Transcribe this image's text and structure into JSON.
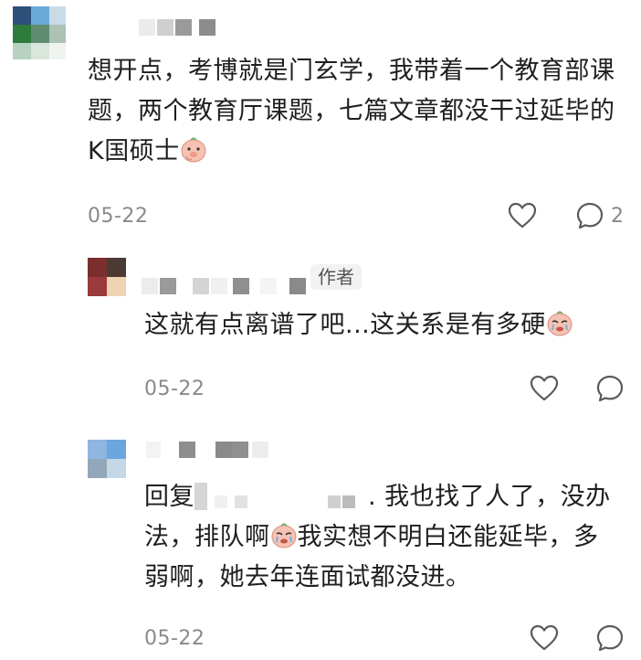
{
  "comments": [
    {
      "date": "05-22",
      "like_count": "",
      "reply_count": "2",
      "lines": [
        "想开点，考博就是门玄学，我带着一个教育部课",
        "题，两个教育厅课题，七篇文章都没干过延毕的",
        "K国硕士"
      ]
    }
  ],
  "replies": [
    {
      "author_tag": "作者",
      "date": "05-22",
      "text": "这就有点离谱了吧...这关系是有多硬"
    },
    {
      "date": "05-22",
      "prefix": "回复",
      "line1_tail": ". 我也找了人了，没办",
      "line2_a": "法，排队啊",
      "line2_b": "我实想不明白还能延毕，多",
      "line3": "弱啊，她去年连面试都没进。"
    }
  ],
  "icons": {
    "emoji": "pig-face-emoji",
    "like": "heart-icon",
    "reply": "comment-bubble-icon"
  },
  "colors": {
    "text": "#1f1f1f",
    "meta": "#8a8a8a",
    "tag_bg": "#f2f2f2"
  }
}
